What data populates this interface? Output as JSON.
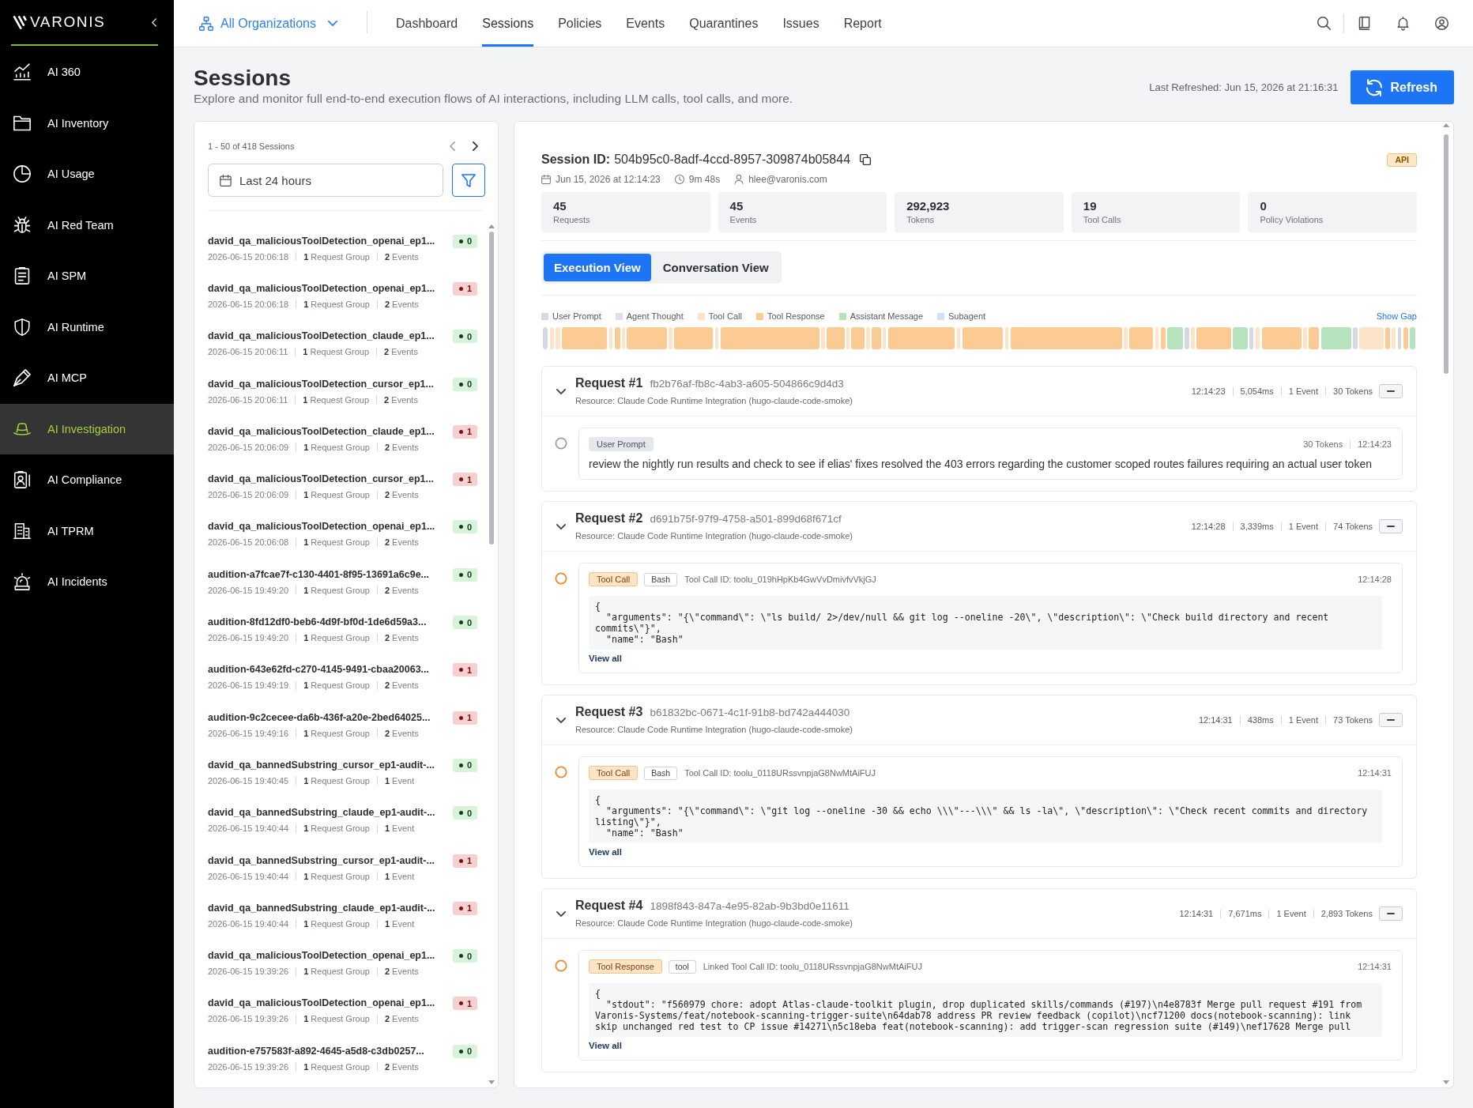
{
  "sidebar": {
    "logo": "VARONIS",
    "items": [
      {
        "label": "AI 360",
        "selected": false
      },
      {
        "label": "AI Inventory",
        "selected": false
      },
      {
        "label": "AI Usage",
        "selected": false
      },
      {
        "label": "AI Red Team",
        "selected": false
      },
      {
        "label": "AI SPM",
        "selected": false
      },
      {
        "label": "AI Runtime",
        "selected": false
      },
      {
        "label": "AI MCP",
        "selected": false
      },
      {
        "label": "AI Investigation",
        "selected": true
      },
      {
        "label": "AI Compliance",
        "selected": false
      },
      {
        "label": "AI TPRM",
        "selected": false
      },
      {
        "label": "AI Incidents",
        "selected": false
      }
    ]
  },
  "topbar": {
    "org_selector": "All Organizations",
    "tabs": [
      {
        "label": "Dashboard",
        "selected": false
      },
      {
        "label": "Sessions",
        "selected": true
      },
      {
        "label": "Policies",
        "selected": false
      },
      {
        "label": "Events",
        "selected": false
      },
      {
        "label": "Quarantines",
        "selected": false
      },
      {
        "label": "Issues",
        "selected": false
      },
      {
        "label": "Report",
        "selected": false
      }
    ]
  },
  "page": {
    "title": "Sessions",
    "subtitle": "Explore and monitor full end-to-end execution flows of AI interactions, including LLM calls, tool calls, and more.",
    "last_refreshed": "Last Refreshed: Jun 15, 2026 at 21:16:31",
    "refresh_button": "Refresh"
  },
  "session_list": {
    "count": "1 - 50 of 418 Sessions",
    "previous_page": {
      "disabled": true
    },
    "next_page": {
      "disabled": false
    },
    "date_range": "Last 24 hours",
    "sessions": [
      {
        "name": "david_qa_maliciousToolDetection_openai_ep1...",
        "time": "2026-06-15 20:06:18",
        "request_groups": "**1** Request Group",
        "events": "**2** Events",
        "alerts": "0",
        "flagged": false
      },
      {
        "name": "david_qa_maliciousToolDetection_openai_ep1...",
        "time": "2026-06-15 20:06:18",
        "request_groups": "**1** Request Group",
        "events": "**2** Events",
        "alerts": "1",
        "flagged": true
      },
      {
        "name": "david_qa_maliciousToolDetection_claude_ep1...",
        "time": "2026-06-15 20:06:11",
        "request_groups": "**1** Request Group",
        "events": "**2** Events",
        "alerts": "0",
        "flagged": false
      },
      {
        "name": "david_qa_maliciousToolDetection_cursor_ep1...",
        "time": "2026-06-15 20:06:11",
        "request_groups": "**1** Request Group",
        "events": "**2** Events",
        "alerts": "0",
        "flagged": false
      },
      {
        "name": "david_qa_maliciousToolDetection_claude_ep1...",
        "time": "2026-06-15 20:06:09",
        "request_groups": "**1** Request Group",
        "events": "**2** Events",
        "alerts": "1",
        "flagged": true
      },
      {
        "name": "david_qa_maliciousToolDetection_cursor_ep1...",
        "time": "2026-06-15 20:06:09",
        "request_groups": "**1** Request Group",
        "events": "**2** Events",
        "alerts": "1",
        "flagged": true
      },
      {
        "name": "david_qa_maliciousToolDetection_openai_ep1...",
        "time": "2026-06-15 20:06:08",
        "request_groups": "**1** Request Group",
        "events": "**2** Events",
        "alerts": "0",
        "flagged": false
      },
      {
        "name": "audition-a7fcae7f-c130-4401-8f95-13691a6c9e...",
        "time": "2026-06-15 19:49:20",
        "request_groups": "**1** Request Group",
        "events": "**2** Events",
        "alerts": "0",
        "flagged": false
      },
      {
        "name": "audition-8fd12df0-beb6-4d9f-bf0d-1de6d59a3...",
        "time": "2026-06-15 19:49:20",
        "request_groups": "**1** Request Group",
        "events": "**2** Events",
        "alerts": "0",
        "flagged": false
      },
      {
        "name": "audition-643e62fd-c270-4145-9491-cbaa20063...",
        "time": "2026-06-15 19:49:19",
        "request_groups": "**1** Request Group",
        "events": "**2** Events",
        "alerts": "1",
        "flagged": true
      },
      {
        "name": "audition-9c2cecee-da6b-436f-a20e-2bed64025...",
        "time": "2026-06-15 19:49:16",
        "request_groups": "**1** Request Group",
        "events": "**2** Events",
        "alerts": "1",
        "flagged": true
      },
      {
        "name": "david_qa_bannedSubstring_cursor_ep1-audit-...",
        "time": "2026-06-15 19:40:45",
        "request_groups": "**1** Request Group",
        "events": "**1** Event",
        "alerts": "0",
        "flagged": false
      },
      {
        "name": "david_qa_bannedSubstring_claude_ep1-audit-...",
        "time": "2026-06-15 19:40:44",
        "request_groups": "**1** Request Group",
        "events": "**1** Event",
        "alerts": "0",
        "flagged": false
      },
      {
        "name": "david_qa_bannedSubstring_cursor_ep1-audit-...",
        "time": "2026-06-15 19:40:44",
        "request_groups": "**1** Request Group",
        "events": "**1** Event",
        "alerts": "1",
        "flagged": true
      },
      {
        "name": "david_qa_bannedSubstring_claude_ep1-audit-...",
        "time": "2026-06-15 19:40:44",
        "request_groups": "**1** Request Group",
        "events": "**1** Event",
        "alerts": "1",
        "flagged": true
      },
      {
        "name": "david_qa_maliciousToolDetection_openai_ep1...",
        "time": "2026-06-15 19:39:26",
        "request_groups": "**1** Request Group",
        "events": "**2** Events",
        "alerts": "0",
        "flagged": false
      },
      {
        "name": "david_qa_maliciousToolDetection_openai_ep1...",
        "time": "2026-06-15 19:39:26",
        "request_groups": "**1** Request Group",
        "events": "**2** Events",
        "alerts": "1",
        "flagged": true
      },
      {
        "name": "audition-e757583f-a892-4645-a5d8-c3db0257...",
        "time": "2026-06-15 19:39:26",
        "request_groups": "**1** Request Group",
        "events": "**2** Events",
        "alerts": "0",
        "flagged": false
      }
    ]
  },
  "session": {
    "id_label": "Session ID:",
    "id": "504b95c0-8adf-4ccd-8957-309874b05844",
    "source": "API",
    "started": "Jun 15, 2026 at 12:14:23",
    "duration": "9m 48s",
    "user": "hlee@varonis.com",
    "stats": [
      {
        "value": "45",
        "label": "Requests"
      },
      {
        "value": "45",
        "label": "Events"
      },
      {
        "value": "292,923",
        "label": "Tokens"
      },
      {
        "value": "19",
        "label": "Tool Calls"
      },
      {
        "value": "0",
        "label": "Policy Violations"
      }
    ],
    "views": [
      {
        "label": "Execution View",
        "selected": true
      },
      {
        "label": "Conversation View",
        "selected": false
      }
    ],
    "legend": [
      {
        "label": "User Prompt",
        "color": "#d6dae0"
      },
      {
        "label": "Agent Thought",
        "color": "#e2dbf4"
      },
      {
        "label": "Tool Call",
        "color": "#fde4c8"
      },
      {
        "label": "Tool Response",
        "color": "#fccb94"
      },
      {
        "label": "Assistant Message",
        "color": "#b6e2bd"
      },
      {
        "label": "Subagent",
        "color": "#cfe1f8"
      }
    ],
    "show_gap": "Show Gap",
    "requests": [
      {
        "title": "Request #1",
        "id": "fb2b76af-fb8c-4ab3-a605-504866c9d4d3",
        "resource": "Resource: Claude Code Runtime Integration (hugo-claude-code-smoke)",
        "time": "12:14:23",
        "duration": "5,054ms",
        "events": "1 Event",
        "tokens": "30 Tokens",
        "expanded": true,
        "event": {
          "kind": "user_prompt",
          "type_label": "User Prompt",
          "tokens": "30 Tokens",
          "time": "12:14:23",
          "text": "review the nightly run results and check to see if elias' fixes resolved the 403 errors regarding the customer scoped routes failures requiring an actual user token"
        }
      },
      {
        "title": "Request #2",
        "id": "d691b75f-97f9-4758-a501-899d68f671cf",
        "resource": "Resource: Claude Code Runtime Integration (hugo-claude-code-smoke)",
        "time": "12:14:28",
        "duration": "3,339ms",
        "events": "1 Event",
        "tokens": "74 Tokens",
        "expanded": true,
        "event": {
          "kind": "tool_call",
          "type_label": "Tool Call",
          "tool": "Bash",
          "call_id": "Tool Call ID: toolu_019hHpKb4GwVvDmivfvVkjGJ",
          "time": "12:14:28",
          "code": [
            "{",
            "  \"arguments\": \"{\\\"command\\\": \\\"ls build/ 2>/dev/null && git log --oneline -20\\\", \\\"description\\\": \\\"Check build directory and recent commits\\\"}\",",
            "  \"name\": \"Bash\""
          ],
          "view_all": "View all"
        }
      },
      {
        "title": "Request #3",
        "id": "b61832bc-0671-4c1f-91b8-bd742a444030",
        "resource": "Resource: Claude Code Runtime Integration (hugo-claude-code-smoke)",
        "time": "12:14:31",
        "duration": "438ms",
        "events": "1 Event",
        "tokens": "73 Tokens",
        "expanded": true,
        "event": {
          "kind": "tool_call",
          "type_label": "Tool Call",
          "tool": "Bash",
          "call_id": "Tool Call ID: toolu_0118URssvnpjaG8NwMtAiFUJ",
          "time": "12:14:31",
          "code": [
            "{",
            "  \"arguments\": \"{\\\"command\\\": \\\"git log --oneline -30 && echo \\\\\\\"---\\\\\\\" && ls -la\\\", \\\"description\\\": \\\"Check recent commits and directory listing\\\"}\",",
            "  \"name\": \"Bash\""
          ],
          "view_all": "View all"
        }
      },
      {
        "title": "Request #4",
        "id": "1898f843-847a-4e95-82ab-9b3bd0e11611",
        "resource": "Resource: Claude Code Runtime Integration (hugo-claude-code-smoke)",
        "time": "12:14:31",
        "duration": "7,671ms",
        "events": "1 Event",
        "tokens": "2,893 Tokens",
        "expanded": true,
        "event": {
          "kind": "tool_response",
          "type_label": "Tool Response",
          "tool": "tool",
          "call_id": "Linked Tool Call ID: toolu_0118URssvnpjaG8NwMtAiFUJ",
          "time": "12:14:31",
          "code": [
            "{",
            "  \"stdout\": \"f560979 chore: adopt Atlas-claude-toolkit plugin, drop duplicated skills/commands (#197)\\n4e8783f Merge pull request #191 from Varonis-Systems/feat/notebook-scanning-trigger-suite\\n64dab78 address PR review feedback (copilot)\\ncf71200 docs(notebook-scanning): link skip unchanged red test to CP issue #14271\\n5c18eba feat(notebook-scanning): add trigger-scan regression suite (#149)\\nef17628 Merge pull"
          ],
          "view_all": "View all"
        }
      }
    ]
  }
}
